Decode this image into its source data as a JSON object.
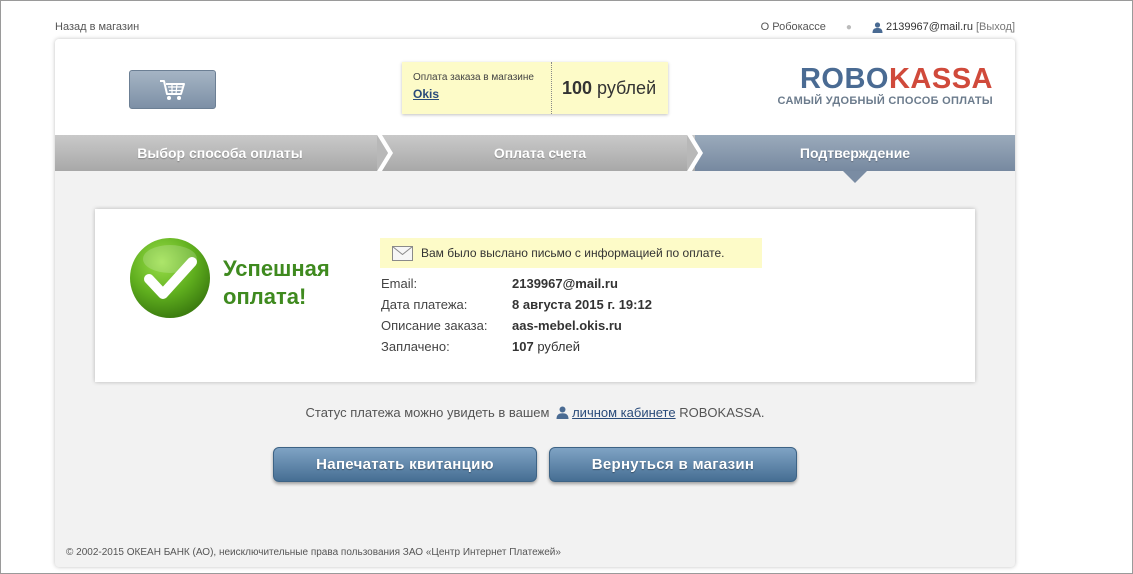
{
  "topbar": {
    "back_link": "Назад в магазин",
    "about_link": "О Робокассе",
    "user_email": "2139967@mail.ru",
    "logout": "[Выход]"
  },
  "header": {
    "order_label": "Оплата заказа в магазине",
    "shop_name": "Okis",
    "amount_value": "100",
    "amount_unit": "рублей",
    "logo_part1": "ROBO",
    "logo_part2": "KASSA",
    "slogan": "САМЫЙ УДОБНЫЙ СПОСОБ ОПЛАТЫ",
    "cart_icon": "cart-icon"
  },
  "steps": [
    {
      "label": "Выбор способа оплаты",
      "active": false
    },
    {
      "label": "Оплата счета",
      "active": false
    },
    {
      "label": "Подтверждение",
      "active": true
    }
  ],
  "result": {
    "title_line1": "Успешная",
    "title_line2": "оплата!",
    "notice": "Вам было выслано письмо с информацией по оплате.",
    "fields": [
      {
        "label": "Email:",
        "value": "2139967@mail.ru",
        "suffix": ""
      },
      {
        "label": "Дата платежа:",
        "value": "8 августа 2015 г. 19:12",
        "suffix": ""
      },
      {
        "label": "Описание заказа:",
        "value": "aas-mebel.okis.ru",
        "suffix": ""
      },
      {
        "label": "Заплачено:",
        "value": "107",
        "suffix": " рублей"
      }
    ]
  },
  "status": {
    "text_before": "Статус платежа можно увидеть в вашем",
    "cabinet_link": "личном кабинете",
    "text_after": "ROBOKASSA."
  },
  "buttons": {
    "print": "Напечатать квитанцию",
    "back": "Вернуться в магазин"
  },
  "footer": {
    "copyright": "© 2002-2015 ОКЕАН БАНК (АО), неисключительные права пользования ЗАО «Центр Интернет Платежей»"
  },
  "colors": {
    "accent_blue": "#4a6b93",
    "accent_red": "#d04a3b",
    "success_green": "#3f8a1f",
    "notice_bg": "#fdfbc8"
  }
}
